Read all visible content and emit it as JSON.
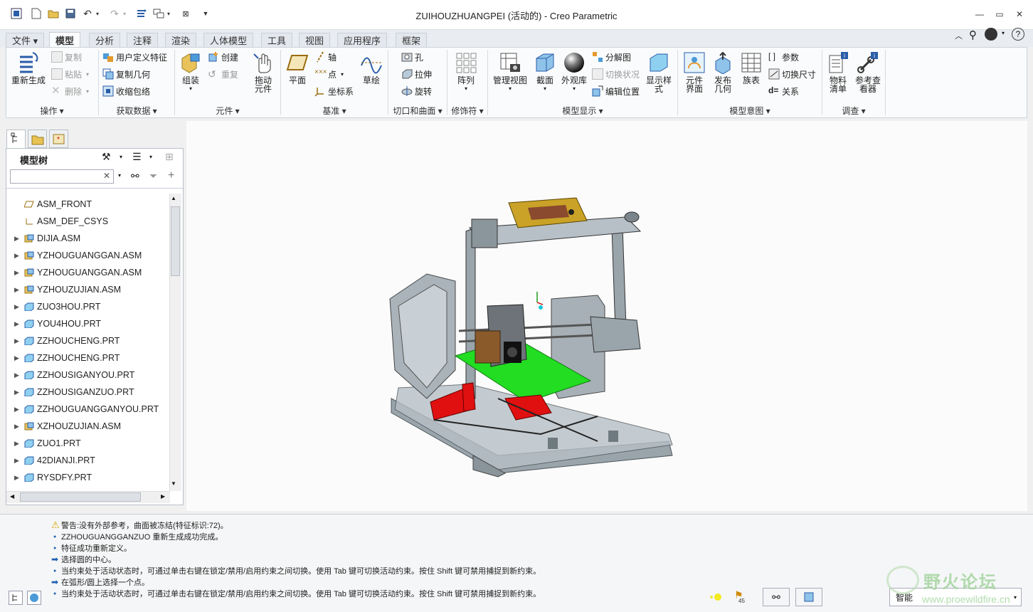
{
  "window": {
    "title": "ZUIHOUZHUANGPEI (活动的) - Creo Parametric"
  },
  "tabs": [
    {
      "label": "文件 ▾"
    },
    {
      "label": "模型"
    },
    {
      "label": "分析"
    },
    {
      "label": "注释"
    },
    {
      "label": "渲染"
    },
    {
      "label": "人体模型"
    },
    {
      "label": "工具"
    },
    {
      "label": "视图"
    },
    {
      "label": "应用程序"
    },
    {
      "label": "框架"
    }
  ],
  "ribbon": {
    "groups": {
      "caozuo": "操作 ▾",
      "huoqu": "获取数据 ▾",
      "yuanjian": "元件 ▾",
      "jizhun": "基准 ▾",
      "qiekou": "切口和曲面 ▾",
      "xiushifu": "修饰符 ▾",
      "moxingxianshi": "模型显示 ▾",
      "moxingyitu": "模型意图 ▾",
      "diaocha": "调查 ▾"
    },
    "regenerate": "重新生成",
    "copy": "复制",
    "paste": "粘贴",
    "delete": "删除",
    "udf": "用户定义特征",
    "copy_geom": "复制几何",
    "shrinkwrap": "收缩包络",
    "assemble": "组装",
    "create": "创建",
    "repeat": "重复",
    "drag": [
      "拖动",
      "元件"
    ],
    "plane": "平面",
    "axis": "轴",
    "point": "点",
    "csys": "坐标系",
    "sketch": "草绘",
    "hole": "孔",
    "extrude": "拉伸",
    "revolve": "旋转",
    "pattern": "阵列",
    "manage_views": "管理视图",
    "section": "截面",
    "appearance": "外观库",
    "explode": "分解图",
    "toggle_status": "切换状况",
    "edit_position": "编辑位置",
    "display_style": [
      "显示样",
      "式"
    ],
    "comp_interface": [
      "元件",
      "界面"
    ],
    "publish_geom": [
      "发布",
      "几何"
    ],
    "family_table": "族表",
    "params": "参数",
    "switch_dims": "切换尺寸",
    "relations": "关系",
    "bom": [
      "物料",
      "清单"
    ],
    "ref_viewer": [
      "参考查",
      "看器"
    ]
  },
  "model_tree": {
    "title": "模型树",
    "search_placeholder": "",
    "items": [
      {
        "label": "ASM_FRONT",
        "type": "plane",
        "expandable": false
      },
      {
        "label": "ASM_DEF_CSYS",
        "type": "csys",
        "expandable": false
      },
      {
        "label": "DIJIA.ASM",
        "type": "asm",
        "expandable": true
      },
      {
        "label": "YZHOUGUANGGAN.ASM",
        "type": "asm",
        "expandable": true
      },
      {
        "label": "YZHOUGUANGGAN.ASM",
        "type": "asm",
        "expandable": true
      },
      {
        "label": "YZHOUZUJIAN.ASM",
        "type": "asm",
        "expandable": true
      },
      {
        "label": "ZUO3HOU.PRT",
        "type": "prt",
        "expandable": true
      },
      {
        "label": "YOU4HOU.PRT",
        "type": "prt",
        "expandable": true
      },
      {
        "label": "ZZHOUCHENG.PRT",
        "type": "prt",
        "expandable": true
      },
      {
        "label": "ZZHOUCHENG.PRT",
        "type": "prt",
        "expandable": true
      },
      {
        "label": "ZZHOUSIGANYOU.PRT",
        "type": "prt",
        "expandable": true
      },
      {
        "label": "ZZHOUSIGANZUO.PRT",
        "type": "prt",
        "expandable": true
      },
      {
        "label": "ZZHOUGUANGGANYOU.PRT",
        "type": "prt",
        "expandable": true
      },
      {
        "label": "XZHOUZUJIAN.ASM",
        "type": "asm",
        "expandable": true
      },
      {
        "label": "ZUO1.PRT",
        "type": "prt",
        "expandable": true
      },
      {
        "label": "42DIANJI.PRT",
        "type": "prt",
        "expandable": true
      },
      {
        "label": "RYSDFY.PRT",
        "type": "prt",
        "expandable": true
      }
    ]
  },
  "messages": [
    {
      "icon": "warning-icon",
      "text": "警告:没有外部参考，曲面被冻结(特征标识:72)。"
    },
    {
      "icon": "bullet",
      "text": "ZZHOUGUANGGANZUO 重新生成成功完成。"
    },
    {
      "icon": "bullet",
      "text": "特征成功重新定义。"
    },
    {
      "icon": "arrow-icon",
      "text": "选择圆的中心。"
    },
    {
      "icon": "bullet",
      "text": "当约束处于活动状态时，可通过单击右键在锁定/禁用/启用约束之间切换。使用 Tab 键可切换活动约束。按住 Shift 键可禁用捕捉到新约束。"
    },
    {
      "icon": "arrow-icon",
      "text": "在弧形/圆上选择一个点。"
    },
    {
      "icon": "bullet",
      "text": "当约束处于活动状态时，可通过单击右键在锁定/禁用/启用约束之间切换。使用 Tab 键可切换活动约束。按住 Shift 键可禁用捕捉到新约束。"
    }
  ],
  "status": {
    "smart": "智能",
    "watermark_brand": "野火论坛",
    "watermark_url": "www.proewildfire.cn",
    "flag_num": "45"
  },
  "colors": {
    "accent": "#1d5fb3",
    "bed": "#22dd22",
    "red_parts": "#e01010",
    "frame": "#9aa4ab",
    "lcd": "#c9a227"
  }
}
